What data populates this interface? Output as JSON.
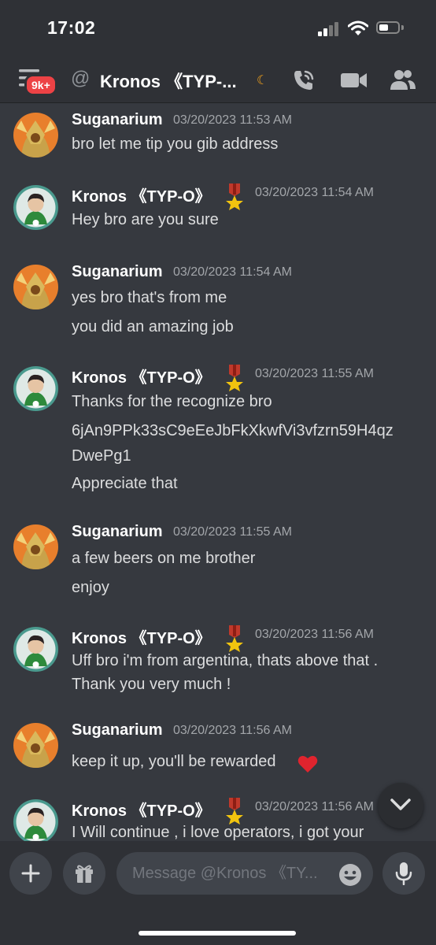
{
  "status_bar": {
    "time": "17:02"
  },
  "header": {
    "notification_badge": "9k+",
    "at_symbol": "@",
    "title": "Kronos 《TYP-...",
    "status_icon": "moon-icon",
    "icons": [
      "hamburger-menu-icon",
      "phone-call-icon",
      "video-camera-icon",
      "members-icon"
    ]
  },
  "messages": [
    {
      "author": "Suganarium",
      "avatar": "suganarium-avatar",
      "timestamp": "03/20/2023 11:53 AM",
      "lines": [
        "bro let me tip you gib address"
      ]
    },
    {
      "author": "Kronos 《TYP-O》",
      "avatar": "kronos-avatar",
      "badge": "medal-icon",
      "timestamp": "03/20/2023 11:54 AM",
      "lines": [
        "Hey bro are you sure"
      ]
    },
    {
      "author": "Suganarium",
      "avatar": "suganarium-avatar",
      "timestamp": "03/20/2023 11:54 AM",
      "lines": [
        "yes bro that's from me",
        "you did an amazing job"
      ]
    },
    {
      "author": "Kronos 《TYP-O》",
      "avatar": "kronos-avatar",
      "badge": "medal-icon",
      "timestamp": "03/20/2023 11:55 AM",
      "lines": [
        "Thanks for the recognize bro",
        "6jAn9PPk33sC9eEeJbFkXkwfVi3vfzrn59H4qz",
        "DwePg1",
        "Appreciate that"
      ]
    },
    {
      "author": "Suganarium",
      "avatar": "suganarium-avatar",
      "timestamp": "03/20/2023 11:55 AM",
      "lines": [
        "a few beers on me brother",
        "enjoy"
      ]
    },
    {
      "author": "Kronos 《TYP-O》",
      "avatar": "kronos-avatar",
      "badge": "medal-icon",
      "timestamp": "03/20/2023 11:56 AM",
      "lines": [
        "Uff bro i'm from argentina, thats above that .",
        "Thank you very much !"
      ]
    },
    {
      "author": "Suganarium",
      "avatar": "suganarium-avatar",
      "timestamp": "03/20/2023 11:56 AM",
      "lines": [
        "keep it up, you'll be rewarded"
      ],
      "emoji": "heart-icon"
    },
    {
      "author": "Kronos 《TYP-O》",
      "avatar": "kronos-avatar",
      "badge": "medal-icon",
      "timestamp": "03/20/2023 11:56 AM",
      "lines": [
        "I Will continue , i love operators, i got your"
      ]
    }
  ],
  "composer": {
    "placeholder": "Message @Kronos 《TY...",
    "icons": [
      "plus-icon",
      "gift-icon",
      "emoji-icon",
      "microphone-icon",
      "chevron-down-icon"
    ]
  },
  "colors": {
    "background": "#36393f",
    "bars": "#2f3136",
    "badge_red": "#ed4245",
    "timestamp": "#a3a6aa",
    "placeholder": "#72767d"
  }
}
